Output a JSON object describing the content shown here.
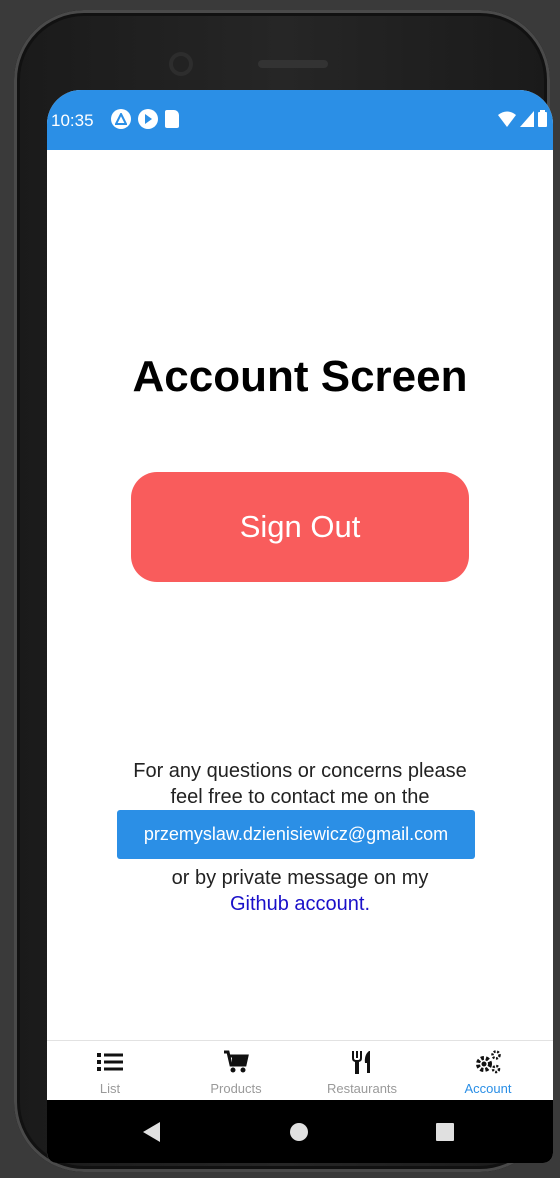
{
  "status_bar": {
    "time": "10:35"
  },
  "main": {
    "title": "Account Screen",
    "sign_out_label": "Sign Out",
    "contact_text_1": "For any questions or concerns please",
    "contact_text_2": "feel free to contact me on the",
    "email": "przemyslaw.dzienisiewicz@gmail.com",
    "contact_text_3": "or by private message on my",
    "github_link": "Github account."
  },
  "tabs": [
    {
      "label": "List",
      "icon": "list-icon"
    },
    {
      "label": "Products",
      "icon": "cart-icon"
    },
    {
      "label": "Restaurants",
      "icon": "fork-knife-icon"
    },
    {
      "label": "Account",
      "icon": "gears-icon",
      "active": true
    }
  ],
  "colors": {
    "accent": "#2b8fe6",
    "sign_out": "#f95c5c",
    "link": "#1a10c9"
  }
}
